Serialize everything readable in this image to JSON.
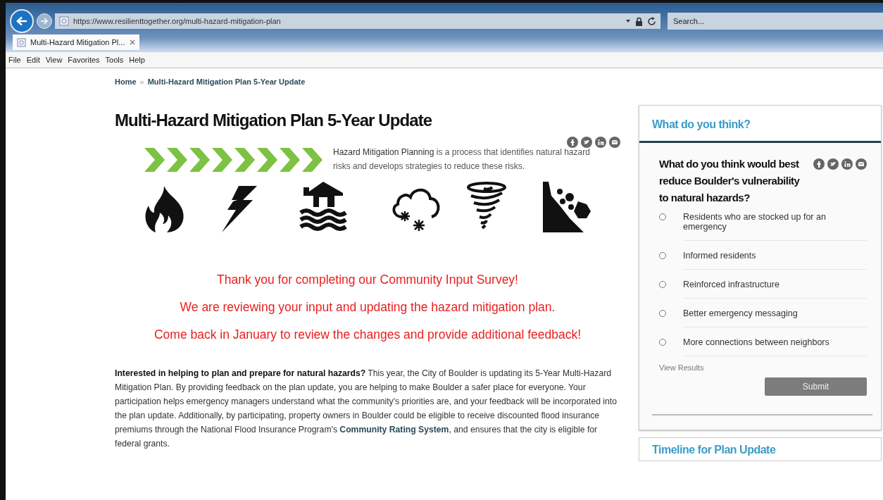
{
  "browser": {
    "address": "https://www.resilienttogether.org/multi-hazard-mitigation-plan",
    "search": {
      "placeholder": "Search..."
    },
    "tabs": [
      {
        "label": "Multi-Hazard Mitigation Pl...",
        "selected": true
      }
    ],
    "menu": [
      "File",
      "Edit",
      "View",
      "Favorites",
      "Tools",
      "Help"
    ]
  },
  "breadcrumb": {
    "items": [
      "Home",
      "Multi-Hazard Mitigation Plan 5-Year Update"
    ],
    "separator": "»"
  },
  "title": "Multi-Hazard Mitigation Plan 5-Year Update",
  "intro": "**Hazard Mitigation Planning** is a process that identifies  natural hazard risks and develops strategies to reduce these risks.",
  "notices": [
    "Thank you for completing our Community Input Survey!",
    "We are reviewing your input and updating the hazard mitigation plan.",
    "Come back in January to review the changes and provide additional feedback!"
  ],
  "body": {
    "text": "**Interested in helping to plan and prepare for natural hazards?** This year, the City of Boulder is updating its 5-Year Multi-Hazard Mitigation Plan. By providing feedback on the plan update, you are helping to make Boulder a safer place for everyone. Your participation helps emergency managers understand what the community's priorities are, and your feedback will be incorporated into the plan update. Additionally, by participating, property owners in Boulder could be eligible to receive discounted flood insurance premiums through the National Flood Insurance Program's",
    "link": "Community Rating System",
    "after": ", and ensures that the city is eligible for federal grants."
  },
  "poll": {
    "header": "What do you think?",
    "question": "What do you think would best reduce Boulder's vulnerability to natural hazards?",
    "options": [
      {
        "label": "Residents who are stocked up for an emergency",
        "selected": false
      },
      {
        "label": "Informed residents",
        "selected": false
      },
      {
        "label": "Reinforced infrastructure",
        "selected": false
      },
      {
        "label": "Better emergency messaging",
        "selected": false
      },
      {
        "label": "More connections between neighbors",
        "selected": false
      }
    ],
    "results_link": "View Results",
    "submit": "Submit"
  },
  "timeline": {
    "header": "Timeline for Plan Update"
  }
}
